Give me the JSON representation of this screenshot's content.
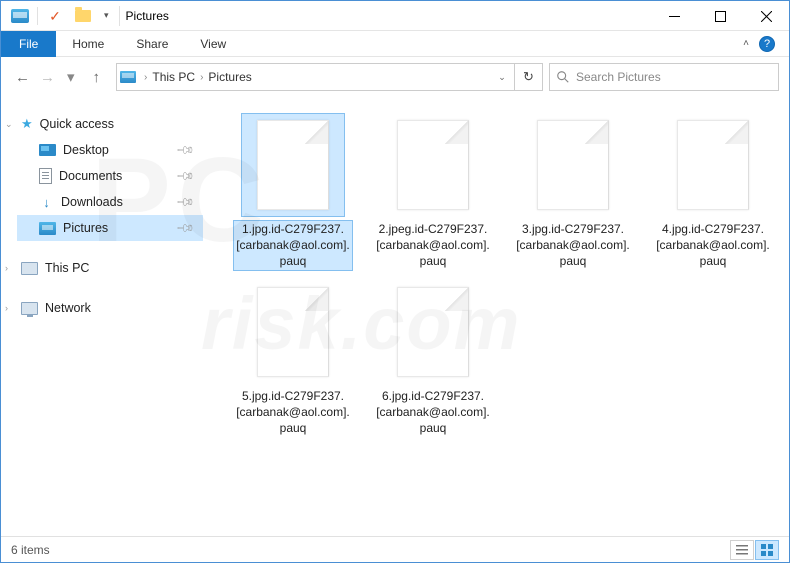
{
  "window": {
    "title": "Pictures"
  },
  "ribbon": {
    "file": "File",
    "tabs": [
      "Home",
      "Share",
      "View"
    ]
  },
  "address": {
    "crumbs": [
      "This PC",
      "Pictures"
    ]
  },
  "search": {
    "placeholder": "Search Pictures"
  },
  "sidebar": {
    "quick_access": "Quick access",
    "items": [
      {
        "label": "Desktop",
        "pinned": true
      },
      {
        "label": "Documents",
        "pinned": true
      },
      {
        "label": "Downloads",
        "pinned": true
      },
      {
        "label": "Pictures",
        "pinned": true,
        "selected": true
      }
    ],
    "this_pc": "This PC",
    "network": "Network"
  },
  "files": [
    {
      "name": "1.jpg.id-C279F237.[carbanak@aol.com].pauq",
      "selected": true
    },
    {
      "name": "2.jpeg.id-C279F237.[carbanak@aol.com].pauq"
    },
    {
      "name": "3.jpg.id-C279F237.[carbanak@aol.com].pauq"
    },
    {
      "name": "4.jpg.id-C279F237.[carbanak@aol.com].pauq"
    },
    {
      "name": "5.jpg.id-C279F237.[carbanak@aol.com].pauq"
    },
    {
      "name": "6.jpg.id-C279F237.[carbanak@aol.com].pauq"
    }
  ],
  "status": {
    "count": "6 items"
  }
}
